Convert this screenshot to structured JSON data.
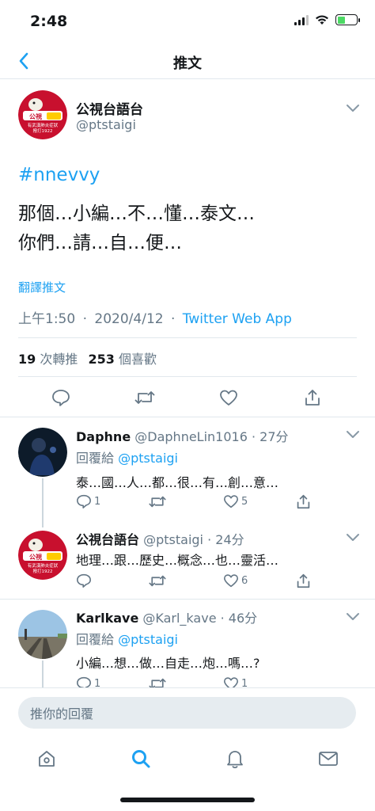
{
  "status_bar": {
    "time": "2:48"
  },
  "nav": {
    "title": "推文"
  },
  "tweet": {
    "author_name": "公視台語台",
    "author_handle": "@ptstaigi",
    "hashtag": "#nnevvy",
    "line1": "那個…小編…不…懂…泰文…",
    "line2": "你們…請…自…便…",
    "translate": "翻譯推文",
    "time": "上午1:50",
    "sep": "·",
    "date": "2020/4/12",
    "client": "Twitter Web App",
    "retweets_count": "19",
    "retweets_label": "次轉推",
    "likes_count": "253",
    "likes_label": "個喜歡"
  },
  "avatar_badge": {
    "brand": "公視",
    "lines": [
      "有武漢肺炎症狀",
      "撥打1922"
    ]
  },
  "replies": [
    {
      "name": "Daphne",
      "handle": "@DaphneLin1016",
      "time": "· 27分",
      "reply_to_label": "回覆給",
      "reply_to": "@ptstaigi",
      "text": "泰…國…人…都…很…有…創…意…",
      "reply_count": "1",
      "like_count": "5"
    },
    {
      "name": "公視台語台",
      "handle": "@ptstaigi",
      "time": "· 24分",
      "text": "地理…跟…歷史…概念…也…靈活…",
      "like_count": "6"
    },
    {
      "name": "Karlkave",
      "handle": "@Karl_kave",
      "time": "· 46分",
      "reply_to_label": "回覆給",
      "reply_to": "@ptstaigi",
      "text": "小編…想…做…自走…炮…嗎…?",
      "reply_count": "1",
      "like_count": "1"
    }
  ],
  "composer": {
    "placeholder": "推你的回覆"
  },
  "colors": {
    "accent": "#1da1f2",
    "text": "#14171a",
    "muted": "#657786",
    "border": "#e1e8ed"
  }
}
